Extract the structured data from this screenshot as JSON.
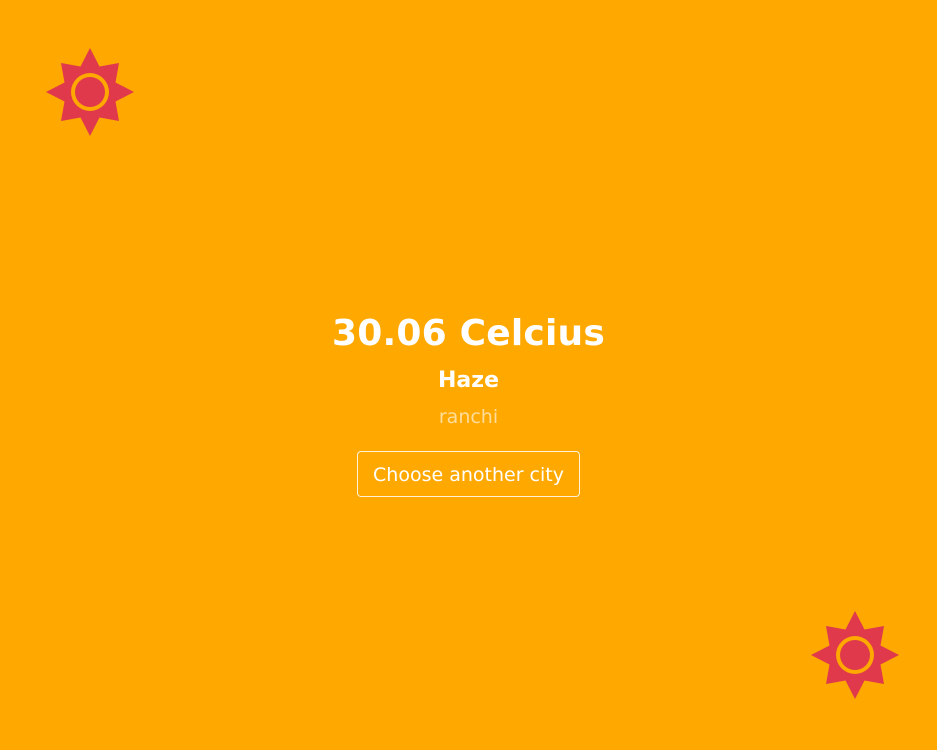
{
  "colors": {
    "background": "#FFA800",
    "sun_rays": "#E0394B",
    "sun_ring": "#FFA800",
    "text": "#FFFFFF"
  },
  "icons": {
    "top_left": "sun-icon",
    "bottom_right": "sun-icon"
  },
  "weather": {
    "temperature": "30.06 Celcius",
    "description": "Haze",
    "city": "ranchi"
  },
  "actions": {
    "choose_city_label": "Choose another city"
  }
}
